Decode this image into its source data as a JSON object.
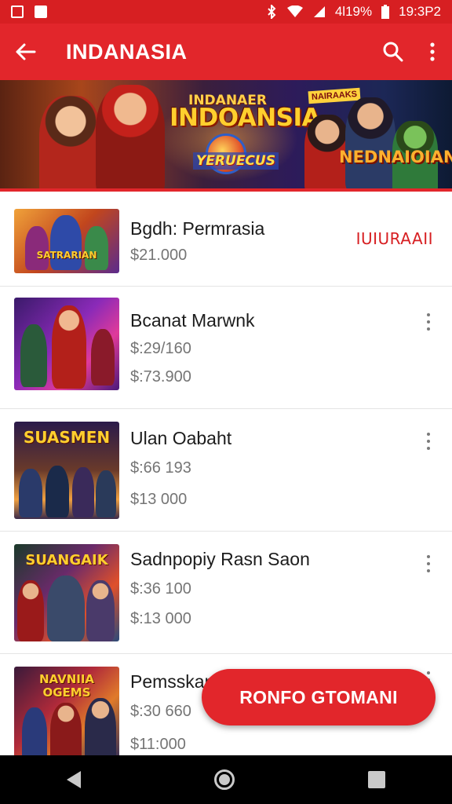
{
  "status_bar": {
    "battery_percent": "4l19%",
    "time": "19:3P2"
  },
  "app_bar": {
    "title": "INDANASIA",
    "icons": [
      "back-arrow-icon",
      "search-icon",
      "more-vert-icon"
    ]
  },
  "banner": {
    "small_title": "INDANAER",
    "main_title": "INDOANSIA",
    "circle_label": "YERUECUS",
    "tag": "NAIRAAKS",
    "right_title": "NEDNAIOIAN"
  },
  "items": [
    {
      "name": "Bgdh: Permrasia",
      "prices": [
        "$21.000"
      ],
      "side_label": "IUIURAAII",
      "thumb_title": "SATRARIAN"
    },
    {
      "name": "Bcanat Marwnk",
      "prices": [
        "$:29/160",
        "$:73.900"
      ],
      "thumb_title": ""
    },
    {
      "name": "Ulan Oabaht",
      "prices": [
        "$:66 193",
        "$13 000"
      ],
      "thumb_title": "SUASMEN"
    },
    {
      "name": "Sadnpopiy Rasn Saon",
      "prices": [
        "$:36 100",
        "$:13 000"
      ],
      "thumb_title": "SUANGAIK"
    },
    {
      "name": "Pemsskan",
      "prices": [
        "$:30 660",
        "$11:000"
      ],
      "thumb_title": "NAVNIIA OGEMS"
    }
  ],
  "fab": {
    "label": "RONFO GTOMANI"
  },
  "nav_bar": {
    "icons": [
      "nav-back-icon",
      "nav-home-icon",
      "nav-recents-icon"
    ]
  },
  "colors": {
    "primary": "#e2262b",
    "status_bar": "#d71f22",
    "price_text": "#757575"
  }
}
